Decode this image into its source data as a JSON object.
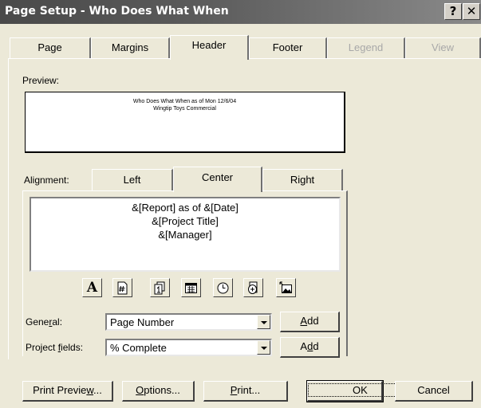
{
  "window": {
    "title": "Page Setup - Who Does What When",
    "help_glyph": "?",
    "close_glyph": "✕"
  },
  "tabs": [
    {
      "label": "Page",
      "state": "normal"
    },
    {
      "label": "Margins",
      "state": "normal"
    },
    {
      "label": "Header",
      "state": "active"
    },
    {
      "label": "Footer",
      "state": "normal"
    },
    {
      "label": "Legend",
      "state": "disabled"
    },
    {
      "label": "View",
      "state": "disabled"
    }
  ],
  "preview": {
    "label": "Preview:",
    "lines": [
      "Who Does What When as of Mon 12/6/04",
      "Wingtip Toys Commercial"
    ]
  },
  "alignment": {
    "label": "Alignment:",
    "tabs": [
      {
        "label": "Left",
        "state": "normal"
      },
      {
        "label": "Center",
        "state": "active"
      },
      {
        "label": "Right",
        "state": "normal"
      }
    ]
  },
  "editor": {
    "lines": [
      "&[Report] as of &[Date]",
      "&[Project Title]",
      "&[Manager]"
    ]
  },
  "toolbar": {
    "icons": [
      "format-text-font-icon",
      "insert-page-number-icon",
      "insert-total-pages-icon",
      "insert-current-date-icon",
      "insert-current-time-icon",
      "insert-file-name-icon",
      "insert-picture-icon"
    ]
  },
  "general": {
    "label_pre": "Gene",
    "label_key": "r",
    "label_post": "al:",
    "value": "Page Number",
    "add_key": "A",
    "add_post": "dd"
  },
  "project_fields": {
    "label_pre": "Project ",
    "label_key": "f",
    "label_post": "ields:",
    "value": "% Complete",
    "add_pre": "A",
    "add_key": "d",
    "add_post": "d"
  },
  "footer_buttons": {
    "print_preview_pre": "Print Previe",
    "print_preview_key": "w",
    "print_preview_post": "...",
    "options_key": "O",
    "options_post": "ptions...",
    "print_key": "P",
    "print_post": "rint...",
    "ok": "OK",
    "cancel": "Cancel"
  }
}
